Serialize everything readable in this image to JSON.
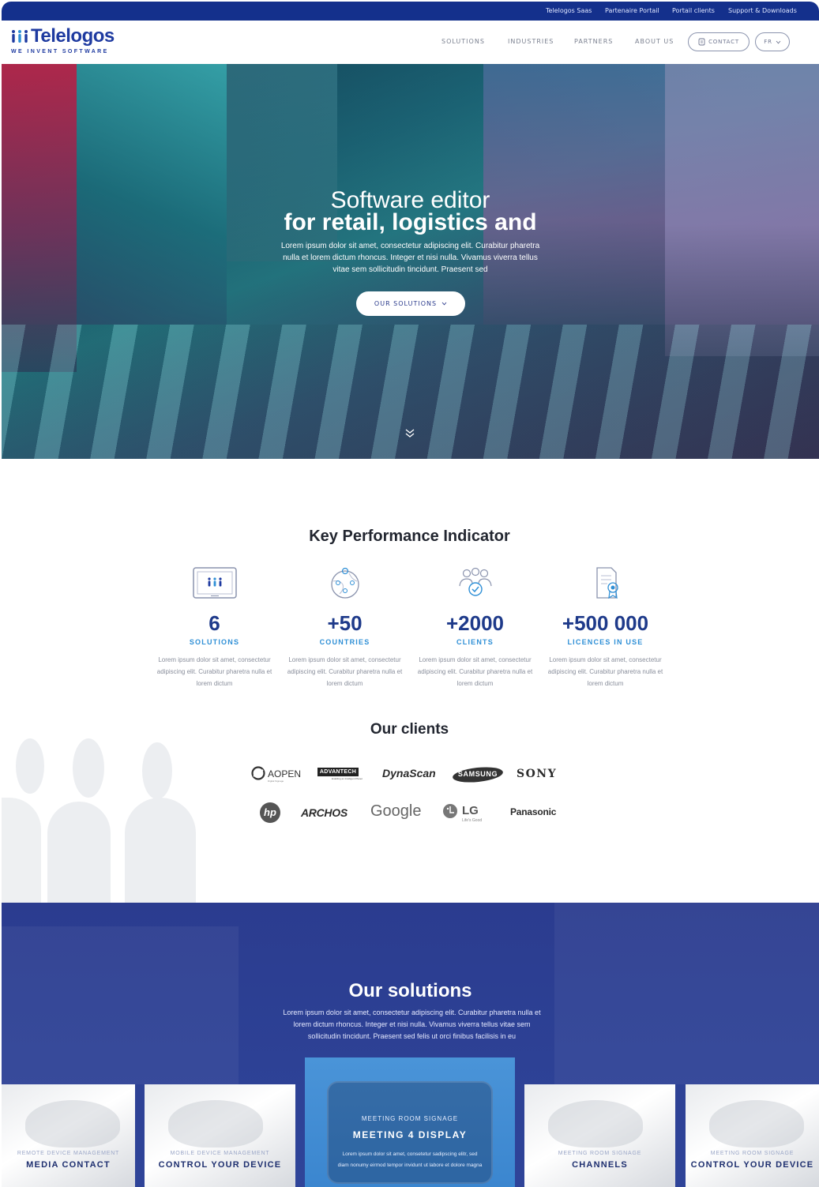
{
  "topbar": {
    "links": [
      "Telelogos Saas",
      "Partenaire Portail",
      "Portail clients",
      "Support & Downloads"
    ]
  },
  "nav": {
    "logo_text": "Telelogos",
    "logo_tagline": "WE INVENT SOFTWARE",
    "links": [
      "SOLUTIONS",
      "INDUSTRIES",
      "PARTNERS",
      "ABOUT US"
    ],
    "contact_label": "CONTACT",
    "lang_label": "FR"
  },
  "hero": {
    "title_line1": "Software editor",
    "title_line2": "for retail, logistics and",
    "description": "Lorem ipsum dolor sit amet, consectetur adipiscing elit. Curabitur pharetra nulla et lorem dictum rhoncus. Integer et nisi nulla. Vivamus viverra tellus vitae sem sollicitudin tincidunt. Praesent sed",
    "cta_label": "OUR SOLUTIONS"
  },
  "kpi": {
    "title": "Key Performance Indicator",
    "items": [
      {
        "icon": "tablet-logo-icon",
        "value": "6",
        "label": "SOLUTIONS",
        "description": "Lorem ipsum dolor sit amet, consectetur adipiscing elit. Curabitur pharetra nulla et lorem dictum"
      },
      {
        "icon": "globe-people-icon",
        "value": "+50",
        "label": "COUNTRIES",
        "description": "Lorem ipsum dolor sit amet, consectetur adipiscing elit. Curabitur pharetra nulla et lorem dictum"
      },
      {
        "icon": "users-check-icon",
        "value": "+2000",
        "label": "CLIENTS",
        "description": "Lorem ipsum dolor sit amet, consectetur adipiscing elit. Curabitur pharetra nulla et lorem dictum"
      },
      {
        "icon": "certificate-icon",
        "value": "+500 000",
        "label": "LICENCES IN USE",
        "description": "Lorem ipsum dolor sit amet, consectetur adipiscing elit. Curabitur pharetra nulla et lorem dictum"
      }
    ]
  },
  "clients": {
    "title": "Our clients",
    "logos": [
      "AOPEN",
      "ADVANTECH",
      "DynaScan",
      "SAMSUNG",
      "SONY",
      "hp",
      "ARCHOS",
      "Google",
      "LG",
      "Panasonic"
    ],
    "aopen_sub": "Digital Signage",
    "advantech_sub": "Enabling an Intelligent Planet",
    "lg_sub": "Life's Good"
  },
  "solutions": {
    "title": "Our solutions",
    "description": "Lorem ipsum dolor sit amet, consectetur adipiscing elit. Curabitur pharetra nulla et lorem dictum rhoncus. Integer et nisi nulla. Vivamus viverra tellus vitae sem sollicitudin tincidunt. Praesent sed felis ut orci finibus facilisis in eu",
    "cards": [
      {
        "kicker": "REMOTE DEVICE MANAGEMENT",
        "title": "MEDIA CONTACT"
      },
      {
        "kicker": "MOBILE DEVICE MANAGEMENT",
        "title": "CONTROL YOUR DEVICE"
      },
      {
        "kicker": "MEETING ROOM SIGNAGE",
        "title": "MEETING 4 DISPLAY",
        "description": "Lorem ipsum dolor sit amet, consetetur sadipscing elitr, sed diam nonumy eirmod tempor invidunt ut labore et dolore magna"
      },
      {
        "kicker": "MEETING ROOM SIGNAGE",
        "title": "CHANNELS"
      },
      {
        "kicker": "MEETING ROOM SIGNAGE",
        "title": "CONTROL YOUR DEVICE"
      }
    ]
  },
  "colors": {
    "brand_blue": "#14308c",
    "accent_blue": "#2e8fd6",
    "solutions_bg": "#2d4195"
  }
}
